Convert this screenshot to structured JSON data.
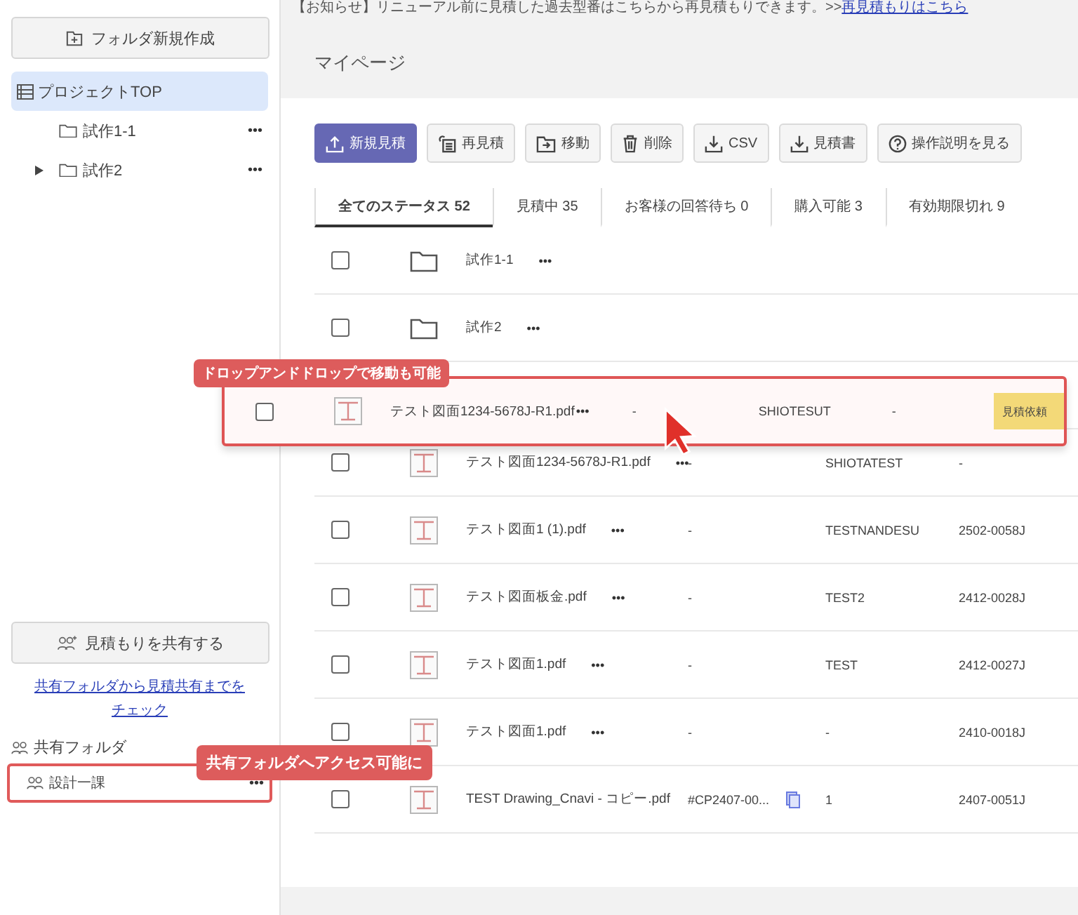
{
  "notice": {
    "text": "【お知らせ】リニューアル前に見積した過去型番はこちらから再見積もりできます。>>",
    "link": "再見積もりはこちら"
  },
  "sidebar": {
    "new_folder_button": "フォルダ新規作成",
    "items": [
      {
        "label": "プロジェクトTOP",
        "selected": true,
        "children": [
          {
            "label": "試作1-1",
            "menu": "•••"
          },
          {
            "label": "試作2",
            "expanded": false,
            "menu": "•••"
          }
        ]
      }
    ],
    "share_button": "見積もりを共有する",
    "share_link": "共有フォルダから見積共有までをチェック",
    "shared_heading": "共有フォルダ",
    "shared_items": [
      {
        "label": "設計一課",
        "highlighted": true,
        "menu": "•••"
      }
    ]
  },
  "page_title": "マイページ",
  "toolbar": [
    {
      "kind": "upload",
      "label": "新規見積",
      "primary": true
    },
    {
      "kind": "requote",
      "label": "再見積",
      "primary": false
    },
    {
      "kind": "move",
      "label": "移動",
      "primary": false
    },
    {
      "kind": "delete",
      "label": "削除",
      "primary": false
    },
    {
      "kind": "download",
      "label": "CSV",
      "primary": false
    },
    {
      "kind": "download",
      "label": "見積書",
      "primary": false
    },
    {
      "kind": "help",
      "label": "操作説明を見る",
      "primary": false
    }
  ],
  "tabs": [
    {
      "label": "全てのステータス 52",
      "selected": true
    },
    {
      "label": "見積中 35",
      "selected": false
    },
    {
      "label": "お客様の回答待ち 0",
      "selected": false
    },
    {
      "label": "購入可能 3",
      "selected": false
    },
    {
      "label": "有効期限切れ 9",
      "selected": false
    }
  ],
  "rows": [
    {
      "kind": "folder",
      "checked": false,
      "name": "試作1-1",
      "menu": "•••"
    },
    {
      "kind": "folder",
      "checked": false,
      "name": "試作2",
      "menu": "•••"
    },
    {
      "kind": "file",
      "dragging": true,
      "checked": false,
      "name": "テスト図面1234-5678J-R1.pdf",
      "menu": "•••",
      "column_3": "-",
      "column_4": "SHIOTESUT",
      "column_5": "-",
      "status": "見積依頼"
    },
    {
      "kind": "file",
      "checked": false,
      "name": "テスト図面1234-5678J-R1.pdf",
      "menu": "•••",
      "column_3": "-",
      "column_4": "SHIOTATEST",
      "column_5": "-"
    },
    {
      "kind": "file",
      "checked": false,
      "name": "テスト図面1 (1).pdf",
      "menu": "•••",
      "column_3": "-",
      "column_4": "TESTNANDESU",
      "column_5": "2502-0058J"
    },
    {
      "kind": "file",
      "checked": false,
      "name": "テスト図面板金.pdf",
      "menu": "•••",
      "column_3": "-",
      "column_4": "TEST2",
      "column_5": "2412-0028J"
    },
    {
      "kind": "file",
      "checked": false,
      "name": "テスト図面1.pdf",
      "menu": "•••",
      "column_3": "-",
      "column_4": "TEST",
      "column_5": "2412-0027J"
    },
    {
      "kind": "file",
      "checked": false,
      "name": "テスト図面1.pdf",
      "menu": "•••",
      "column_3": "-",
      "column_4": "-",
      "column_5": "2410-0018J"
    },
    {
      "kind": "file",
      "checked": false,
      "name": "TEST Drawing_Cnavi - コピー.pdf",
      "column_3": "#CP2407-00...",
      "copy_icon": true,
      "column_4": "1",
      "column_5": "2407-0051J"
    }
  ],
  "callouts": [
    {
      "kind": "drag",
      "text": "ドロップアンドドロップで移動も可能"
    },
    {
      "kind": "shared",
      "text": "共有フォルダへアクセス可能に"
    }
  ]
}
